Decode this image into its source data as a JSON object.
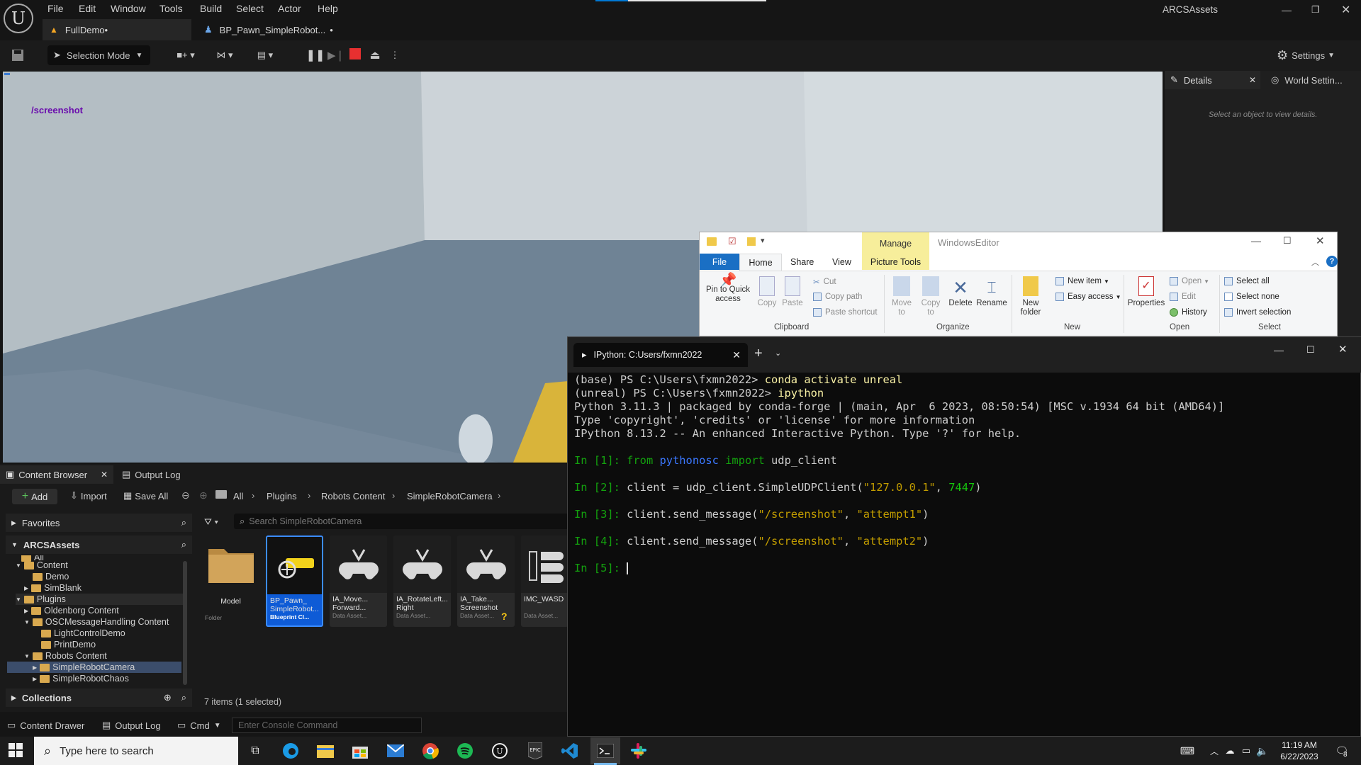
{
  "menu": {
    "items": [
      "File",
      "Edit",
      "Window",
      "Tools",
      "Build",
      "Select",
      "Actor",
      "Help"
    ],
    "project": "ARCSAssets"
  },
  "tabs": {
    "level": "FullDemo•",
    "blueprint": "BP_Pawn_SimpleRobot...",
    "blueprint_dot": "•"
  },
  "toolbar": {
    "selection_mode": "Selection Mode",
    "settings": "Settings"
  },
  "viewport": {
    "overlay_text": "/screenshot"
  },
  "details": {
    "tab": "Details",
    "tab2": "World Settin...",
    "empty_msg": "Select an object to view details."
  },
  "content_browser": {
    "tab": "Content Browser",
    "tab2": "Output Log",
    "add": "Add",
    "import": "Import",
    "save_all": "Save All",
    "breadcrumb": [
      "All",
      "Plugins",
      "Robots Content",
      "SimpleRobotCamera"
    ],
    "favorites": "Favorites",
    "root": "ARCSAssets",
    "search_placeholder": "Search SimpleRobotCamera",
    "tree": [
      "All",
      "Content",
      "Demo",
      "SimBlank",
      "Plugins",
      "Oldenborg Content",
      "OSCMessageHandling Content",
      "LightControlDemo",
      "PrintDemo",
      "Robots Content",
      "SimpleRobotCamera",
      "SimpleRobotChaos"
    ],
    "collections": "Collections",
    "status": "7 items (1 selected)",
    "assets": [
      {
        "name": "Model",
        "type": "Folder"
      },
      {
        "name": "BP_Pawn_ SimpleRobot...",
        "type": "Blueprint Cl..."
      },
      {
        "name": "IA_Move... Forward...",
        "type": "Data Asset..."
      },
      {
        "name": "IA_RotateLeft... Right",
        "type": "Data Asset..."
      },
      {
        "name": "IA_Take... Screenshot",
        "type": "Data Asset..."
      },
      {
        "name": "IMC_WASD",
        "type": "Data Asset..."
      }
    ]
  },
  "bottom_bar": {
    "drawer": "Content Drawer",
    "output_log": "Output Log",
    "cmd": "Cmd",
    "console_placeholder": "Enter Console Command"
  },
  "explorer": {
    "title": "WindowsEditor",
    "manage": "Manage",
    "tabs": [
      "File",
      "Home",
      "Share",
      "View",
      "Picture Tools"
    ],
    "clipboard": {
      "pin": "Pin to Quick access",
      "copy": "Copy",
      "paste": "Paste",
      "cut": "Cut",
      "copy_path": "Copy path",
      "paste_shortcut": "Paste shortcut",
      "label": "Clipboard"
    },
    "organize": {
      "move": "Move to",
      "copy": "Copy to",
      "delete": "Delete",
      "rename": "Rename",
      "label": "Organize"
    },
    "new": {
      "folder": "New folder",
      "item": "New item",
      "easy": "Easy access",
      "label": "New"
    },
    "open": {
      "props": "Properties",
      "open": "Open",
      "edit": "Edit",
      "history": "History",
      "label": "Open"
    },
    "select": {
      "all": "Select all",
      "none": "Select none",
      "invert": "Invert selection",
      "label": "Select"
    }
  },
  "terminal": {
    "tab_title": "IPython: C:Users/fxmn2022",
    "lines": [
      {
        "a": "(base) PS C:\\Users\\fxmn2022> ",
        "b": "conda activate unreal"
      },
      {
        "a": "(unreal) PS C:\\Users\\fxmn2022> ",
        "b": "ipython"
      },
      {
        "a": "Python 3.11.3 | packaged by conda-forge | (main, Apr  6 2023, 08:50:54) [MSC v.1934 64 bit (AMD64)]"
      },
      {
        "a": "Type 'copyright', 'credits' or 'license' for more information"
      },
      {
        "a": "IPython 8.13.2 -- An enhanced Interactive Python. Type '?' for help."
      }
    ],
    "in1": {
      "prompt": "In [1]: ",
      "kw": "from ",
      "mod": "pythonosc",
      "kw2": " import ",
      "rest": "udp_client"
    },
    "in2": {
      "prompt": "In [2]: ",
      "code": "client = udp_client.SimpleUDPClient(",
      "str": "\"127.0.0.1\"",
      "sep": ", ",
      "num": "7447",
      "end": ")"
    },
    "in3": {
      "prompt": "In [3]: ",
      "code": "client.send_message(",
      "s1": "\"/screenshot\"",
      "sep": ", ",
      "s2": "\"attempt1\"",
      "end": ")"
    },
    "in4": {
      "prompt": "In [4]: ",
      "code": "client.send_message(",
      "s1": "\"/screenshot\"",
      "sep": ", ",
      "s2": "\"attempt2\"",
      "end": ")"
    },
    "in5": {
      "prompt": "In [5]: "
    }
  },
  "taskbar": {
    "search": "Type here to search",
    "time": "11:19 AM",
    "date": "6/22/2023",
    "notif": "3"
  }
}
